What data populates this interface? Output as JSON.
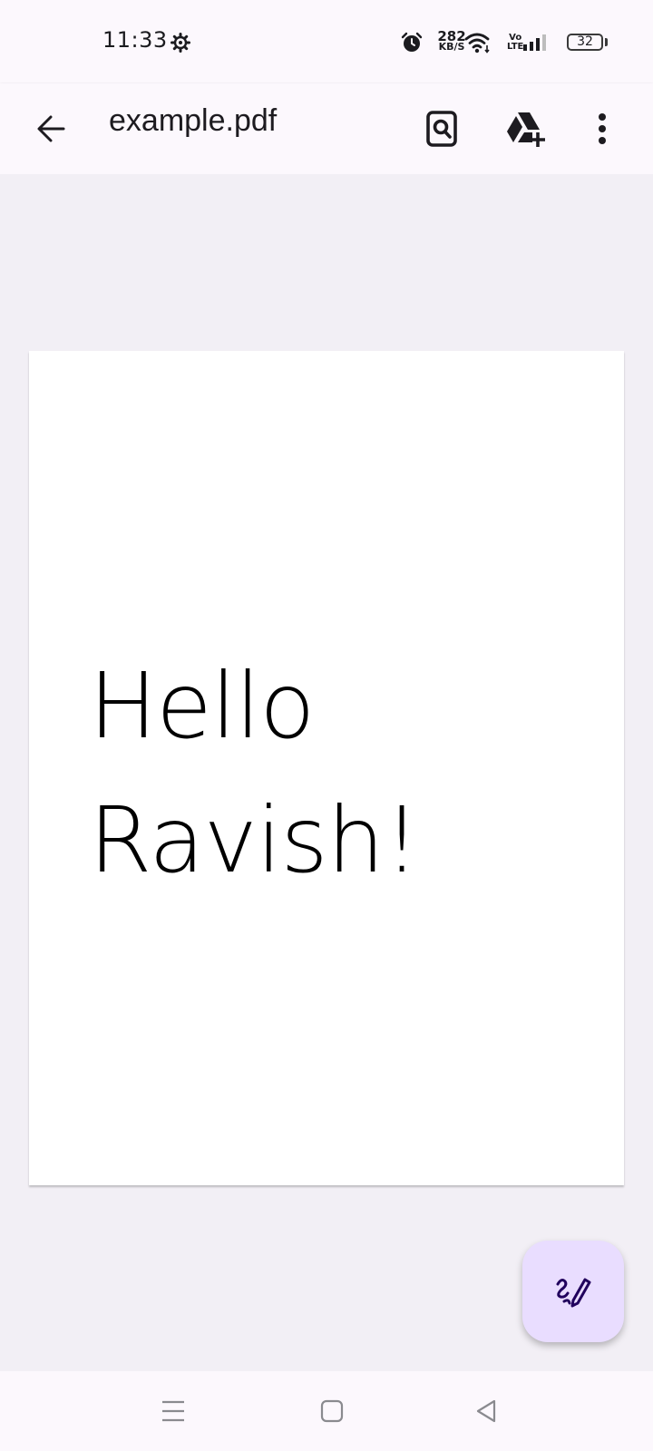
{
  "status_bar": {
    "time": "11:33",
    "net_speed_value": "282",
    "net_speed_unit": "KB/S",
    "volte_top": "Vo",
    "volte_bottom": "LTE",
    "battery_level": "32"
  },
  "app_bar": {
    "back_icon": "arrow-back-icon",
    "title": "example.pdf",
    "actions": [
      {
        "name": "search-in-document",
        "icon": "document-search-icon"
      },
      {
        "name": "save-to-drive",
        "icon": "drive-add-icon"
      },
      {
        "name": "more-options",
        "icon": "more-vert-icon"
      }
    ]
  },
  "document": {
    "lines": [
      "Hello",
      "Ravish!"
    ]
  },
  "fab": {
    "icon": "edit-annotate-icon"
  },
  "nav_bar": {
    "buttons": [
      {
        "name": "recents",
        "icon": "menu-lines-icon"
      },
      {
        "name": "home",
        "icon": "home-square-icon"
      },
      {
        "name": "back",
        "icon": "back-triangle-icon"
      }
    ]
  },
  "colors": {
    "surface": "#fcf8fd",
    "viewer_background": "#f2eff5",
    "fab_container": "#e9ddff",
    "on_surface": "#1d1b20"
  }
}
